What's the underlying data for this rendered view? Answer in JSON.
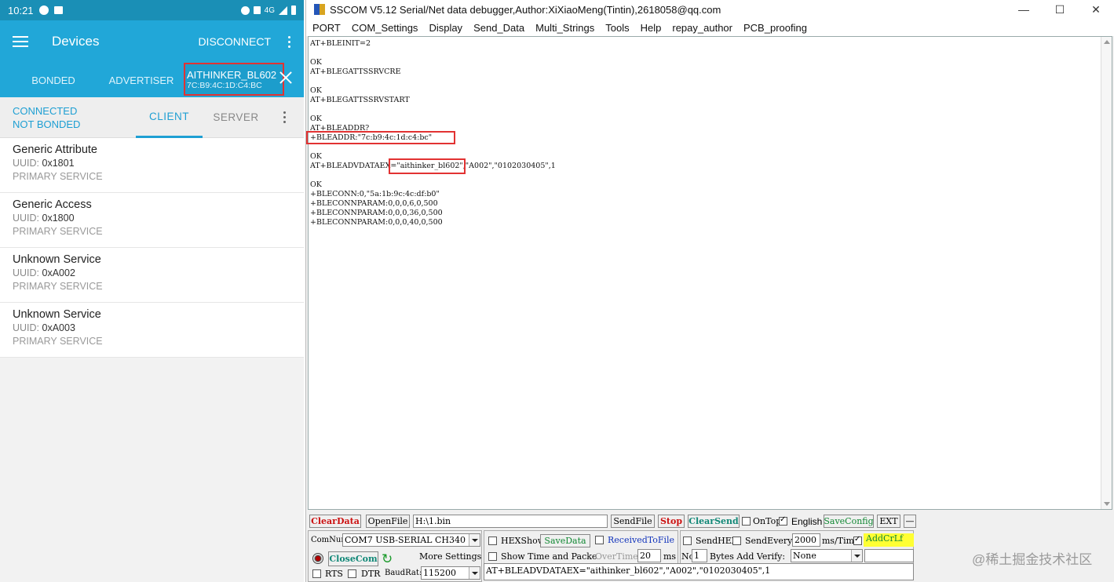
{
  "phone": {
    "time": "10:21",
    "net": "4G",
    "title": "Devices",
    "disconnect": "DISCONNECT",
    "tabs": {
      "bonded": "BONDED",
      "advertiser": "ADVERTISER"
    },
    "device": {
      "name": "AITHINKER_BL602",
      "address": "7C:B9:4C:1D:C4:BC"
    },
    "conn_state": "CONNECTED",
    "bond_state": "NOT BONDED",
    "client": "CLIENT",
    "server": "SERVER",
    "services": [
      {
        "name": "Generic Attribute",
        "uuid_label": "UUID:",
        "uuid": "0x1801",
        "type": "PRIMARY SERVICE"
      },
      {
        "name": "Generic Access",
        "uuid_label": "UUID:",
        "uuid": "0x1800",
        "type": "PRIMARY SERVICE"
      },
      {
        "name": "Unknown Service",
        "uuid_label": "UUID:",
        "uuid": "0xA002",
        "type": "PRIMARY SERVICE"
      },
      {
        "name": "Unknown Service",
        "uuid_label": "UUID:",
        "uuid": "0xA003",
        "type": "PRIMARY SERVICE"
      }
    ],
    "accent": "#21a7d8"
  },
  "window": {
    "title": "SSCOM V5.12 Serial/Net data debugger,Author:XiXiaoMeng(Tintin),2618058@qq.com",
    "minimize": "—",
    "maximize": "☐",
    "close": "✕",
    "menu": [
      "PORT",
      "COM_Settings",
      "Display",
      "Send_Data",
      "Multi_Strings",
      "Tools",
      "Help",
      "repay_author",
      "PCB_proofing"
    ]
  },
  "output_lines": [
    "AT+BLEINIT=2",
    "",
    "OK",
    "AT+BLEGATTSSRVCRE",
    "",
    "OK",
    "AT+BLEGATTSSRVSTART",
    "",
    "OK",
    "AT+BLEADDR?",
    "+BLEADDR:\"7c:b9:4c:1d:c4:bc\"",
    "",
    "OK",
    "AT+BLEADVDATAEX=\"aithinker_bl602\",\"A002\",\"0102030405\",1",
    "",
    "OK",
    "+BLECONN:0,\"5a:1b:9c:4c:df:b0\"",
    "+BLECONNPARAM:0,0,0,6,0,500",
    "+BLECONNPARAM:0,0,0,36,0,500",
    "+BLECONNPARAM:0,0,0,40,0,500"
  ],
  "controls": {
    "clear_data": "ClearData",
    "open_file": "OpenFile",
    "file_path": "H:\\1.bin",
    "send_file": "SendFile",
    "stop": "Stop",
    "clear_send": "ClearSend",
    "on_top": "OnTop",
    "english": "English",
    "save_config": "SaveConfig",
    "ext": "EXT",
    "dash": "—",
    "com_num_label": "ComNum",
    "com_port": "COM7 USB-SERIAL CH340",
    "hex_show": "HEXShow",
    "save_data": "SaveData",
    "received_to_file": "ReceivedToFile",
    "send_hex": "SendHEX",
    "send_every": "SendEvery:",
    "send_every_value": "2000",
    "ms_tim": "ms/Tim",
    "add_crlf": "AddCrLf",
    "close_com": "CloseCom",
    "more_settings": "More Settings",
    "show_time": "Show Time and Packe",
    "overtime_label": "OverTime:",
    "overtime_value": "20",
    "ms": "ms",
    "no_label": "No",
    "no_value": "1",
    "bytes_add_verify": "Bytes Add Verify:",
    "verify_value": "None",
    "rts": "RTS",
    "dtr": "DTR",
    "baud_label": "BaudRat:",
    "baud_value": "115200",
    "send_text": "AT+BLEADVDATAEX=\"aithinker_bl602\",\"A002\",\"0102030405\",1"
  },
  "watermark": "@稀土掘金技术社区"
}
